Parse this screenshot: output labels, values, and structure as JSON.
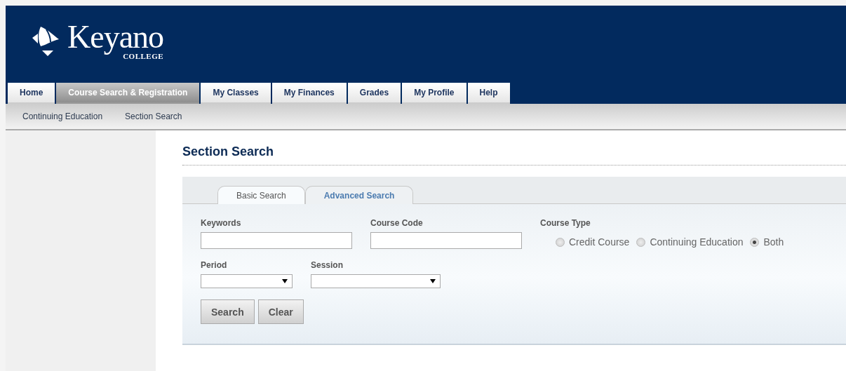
{
  "logo": {
    "name": "Keyano",
    "sub": "COLLEGE"
  },
  "tabs": [
    {
      "label": "Home",
      "selected": false
    },
    {
      "label": "Course Search & Registration",
      "selected": true
    },
    {
      "label": "My Classes",
      "selected": false
    },
    {
      "label": "My Finances",
      "selected": false
    },
    {
      "label": "Grades",
      "selected": false
    },
    {
      "label": "My Profile",
      "selected": false
    },
    {
      "label": "Help",
      "selected": false
    }
  ],
  "subnav": [
    "Continuing Education",
    "Section Search"
  ],
  "page_title": "Section Search",
  "search_tabs": [
    {
      "label": "Basic Search",
      "selected": true
    },
    {
      "label": "Advanced Search",
      "selected": false
    }
  ],
  "fields": {
    "keywords": {
      "label": "Keywords"
    },
    "course_code": {
      "label": "Course Code"
    },
    "course_type": {
      "label": "Course Type",
      "options": [
        {
          "label": "Credit Course",
          "selected": false
        },
        {
          "label": "Continuing Education",
          "selected": false
        },
        {
          "label": "Both",
          "selected": true
        }
      ]
    },
    "period": {
      "label": "Period"
    },
    "session": {
      "label": "Session"
    }
  },
  "buttons": [
    "Search",
    "Clear"
  ]
}
